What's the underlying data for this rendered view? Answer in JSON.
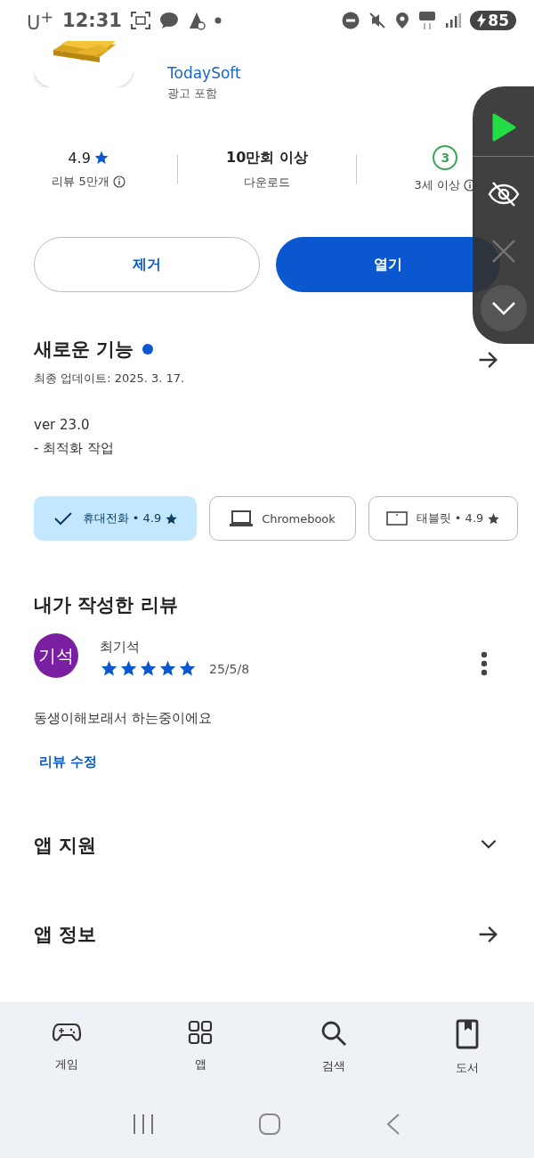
{
  "status_bar": {
    "carrier": "U$^{+}$",
    "time": "12:31",
    "battery": "85"
  },
  "app": {
    "developer": "TodaySoft",
    "ad_notice": "광고 포함"
  },
  "stats": [
    {
      "kind": "rating",
      "value": "4.9",
      "label": "리뷰 5만개",
      "info": true
    },
    {
      "kind": "plain",
      "value": "10만회 이상",
      "label": "다운로드",
      "info": false
    },
    {
      "kind": "age",
      "value": "3",
      "label": "3세 이상",
      "info": true
    }
  ],
  "buttons": [
    {
      "kind": "outline",
      "label": "제거"
    },
    {
      "kind": "filled",
      "label": "열기"
    }
  ],
  "whats_new": {
    "title": "새로운 기능",
    "new_dot": true,
    "updated": "최종 업데이트: 2025. 3. 17.",
    "notes": [
      "ver 23.0",
      "- 최적화 작업"
    ]
  },
  "device_chips": [
    {
      "kind": "phone",
      "label": "휴대전화 • 4.9",
      "starred": true,
      "selected": true
    },
    {
      "kind": "laptop",
      "label": "Chromebook",
      "starred": false,
      "selected": false
    },
    {
      "kind": "tablet",
      "label": "태블릿 • 4.9",
      "starred": true,
      "selected": false
    }
  ],
  "my_review": {
    "heading": "내가 작성한 리뷰",
    "author": "최기석",
    "avatar_text": "기석",
    "stars": 5,
    "date": "25/5/8",
    "text": "동생이해보래서 하는중이에요",
    "edit_link": "리뷰 수정"
  },
  "sections": [
    {
      "kind": "expand",
      "title": "앱 지원"
    },
    {
      "kind": "arrow",
      "title": "앱 정보"
    }
  ],
  "bottom_nav": [
    {
      "kind": "games",
      "label": "게임",
      "selected": false
    },
    {
      "kind": "apps",
      "label": "앱",
      "selected": false
    },
    {
      "kind": "search",
      "label": "검색",
      "selected": false
    },
    {
      "kind": "books",
      "label": "도서",
      "selected": false
    }
  ],
  "overlay": [
    {
      "kind": "play",
      "disabled": false
    },
    {
      "kind": "hide",
      "disabled": false
    },
    {
      "kind": "close",
      "disabled": true
    },
    {
      "kind": "collapse",
      "disabled": false
    }
  ]
}
